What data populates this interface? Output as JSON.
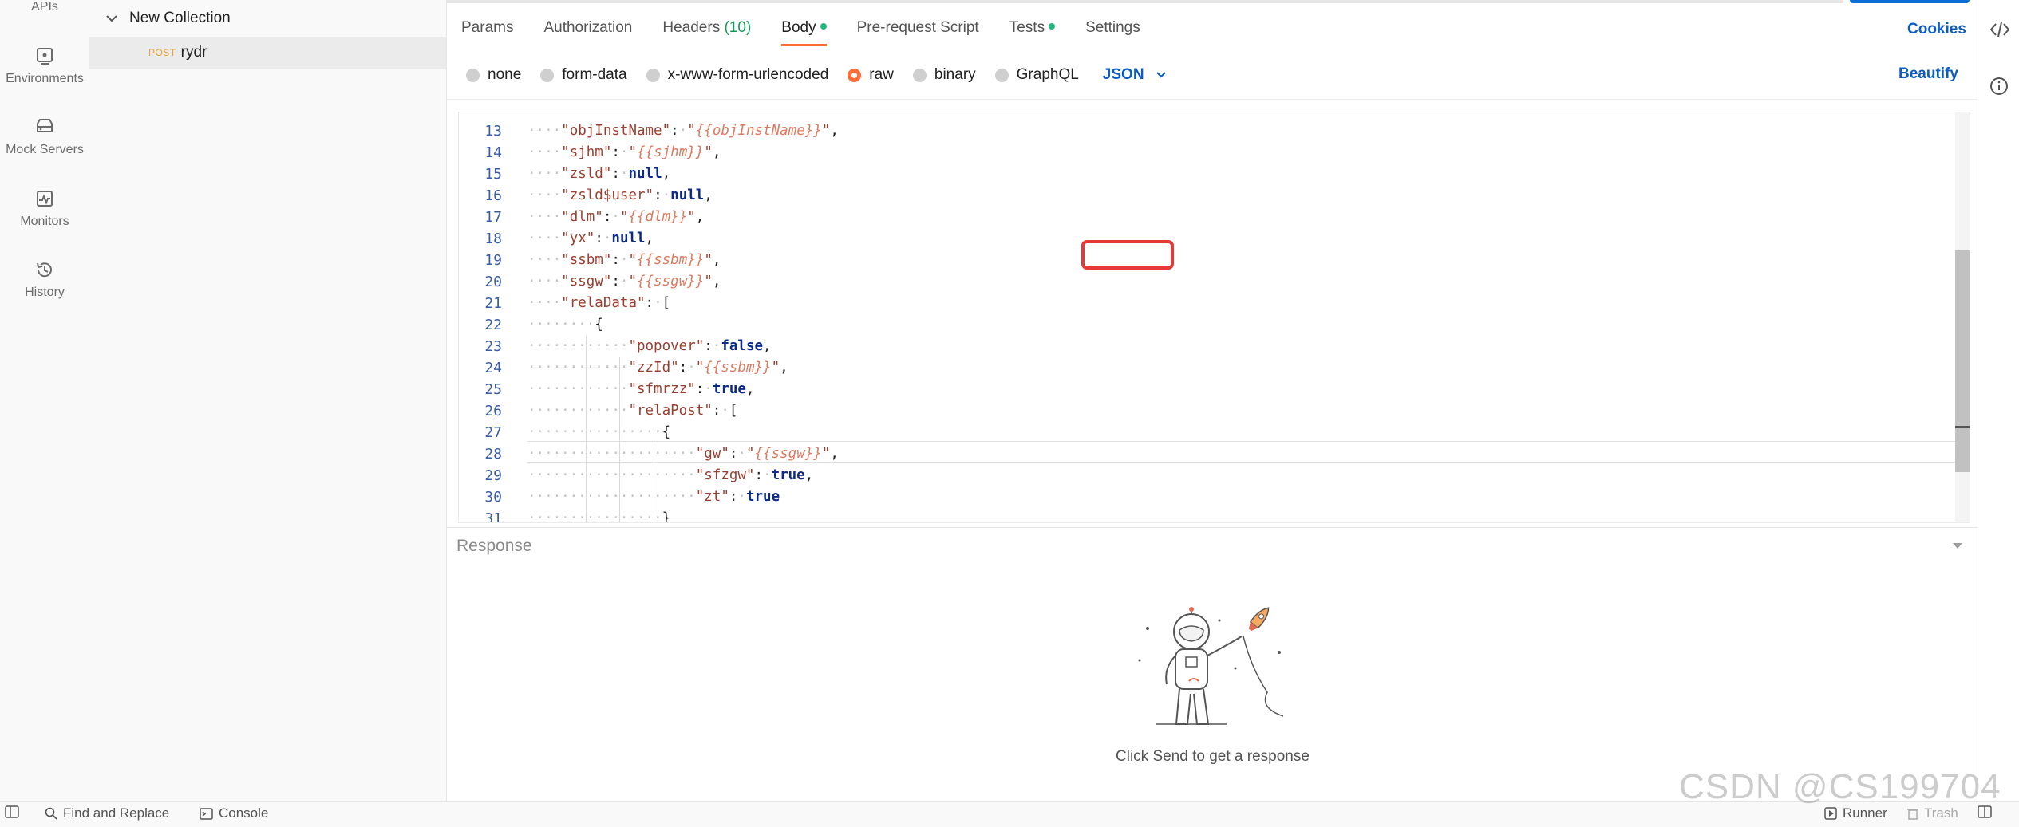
{
  "rail": {
    "items": [
      {
        "label": "APIs",
        "icon": "api-icon"
      },
      {
        "label": "Environments",
        "icon": "environment-icon"
      },
      {
        "label": "Mock Servers",
        "icon": "mock-server-icon"
      },
      {
        "label": "Monitors",
        "icon": "monitor-icon"
      },
      {
        "label": "History",
        "icon": "history-icon"
      }
    ]
  },
  "sidebar": {
    "collection": "New Collection",
    "request": {
      "method": "POST",
      "name": "rydr"
    }
  },
  "tabs": [
    {
      "label": "Params"
    },
    {
      "label": "Authorization"
    },
    {
      "label": "Headers",
      "count": "(10)"
    },
    {
      "label": "Body",
      "active": true,
      "dot": true
    },
    {
      "label": "Pre-request Script"
    },
    {
      "label": "Tests",
      "dot": true
    },
    {
      "label": "Settings"
    }
  ],
  "cookies_label": "Cookies",
  "body_types": [
    "none",
    "form-data",
    "x-www-form-urlencoded",
    "raw",
    "binary",
    "GraphQL"
  ],
  "body_type_selected": "raw",
  "language": "JSON",
  "beautify_label": "Beautify",
  "editor": {
    "line_numbers": [
      "13",
      "14",
      "15",
      "16",
      "17",
      "18",
      "19",
      "20",
      "21",
      "22",
      "23",
      "24",
      "25",
      "26",
      "27",
      "28",
      "29",
      "30",
      "31"
    ],
    "lines": [
      "\"objInstName\": \"{{objInstName}}\",",
      "\"sjhm\": \"{{sjhm}}\",",
      "\"zsld\": null,",
      "\"zsld$user\": null,",
      "\"dlm\": \"{{dlm}}\",",
      "\"yx\": null,",
      "\"ssbm\": \"{{ssbm}}\",",
      "\"ssgw\": \"{{ssgw}}\",",
      "\"relaData\": [",
      "{",
      "\"popover\": false,",
      "\"zzId\": \"{{ssbm}}\",",
      "\"sfmrzz\": true,",
      "\"relaPost\": [",
      "{",
      "\"gw\": \"{{ssgw}}\",",
      "\"sfzgw\": true,",
      "\"zt\": true",
      "}"
    ]
  },
  "response": {
    "title": "Response",
    "hint": "Click Send to get a response"
  },
  "statusbar": {
    "find_replace": "Find and Replace",
    "console": "Console",
    "runner": "Runner",
    "trash": "Trash"
  },
  "watermark": "CSDN @CS199704",
  "colors": {
    "accent": "#ff6c37",
    "link": "#0b5cc5",
    "highlight": "#e53935",
    "variable": "#e07a5f"
  }
}
